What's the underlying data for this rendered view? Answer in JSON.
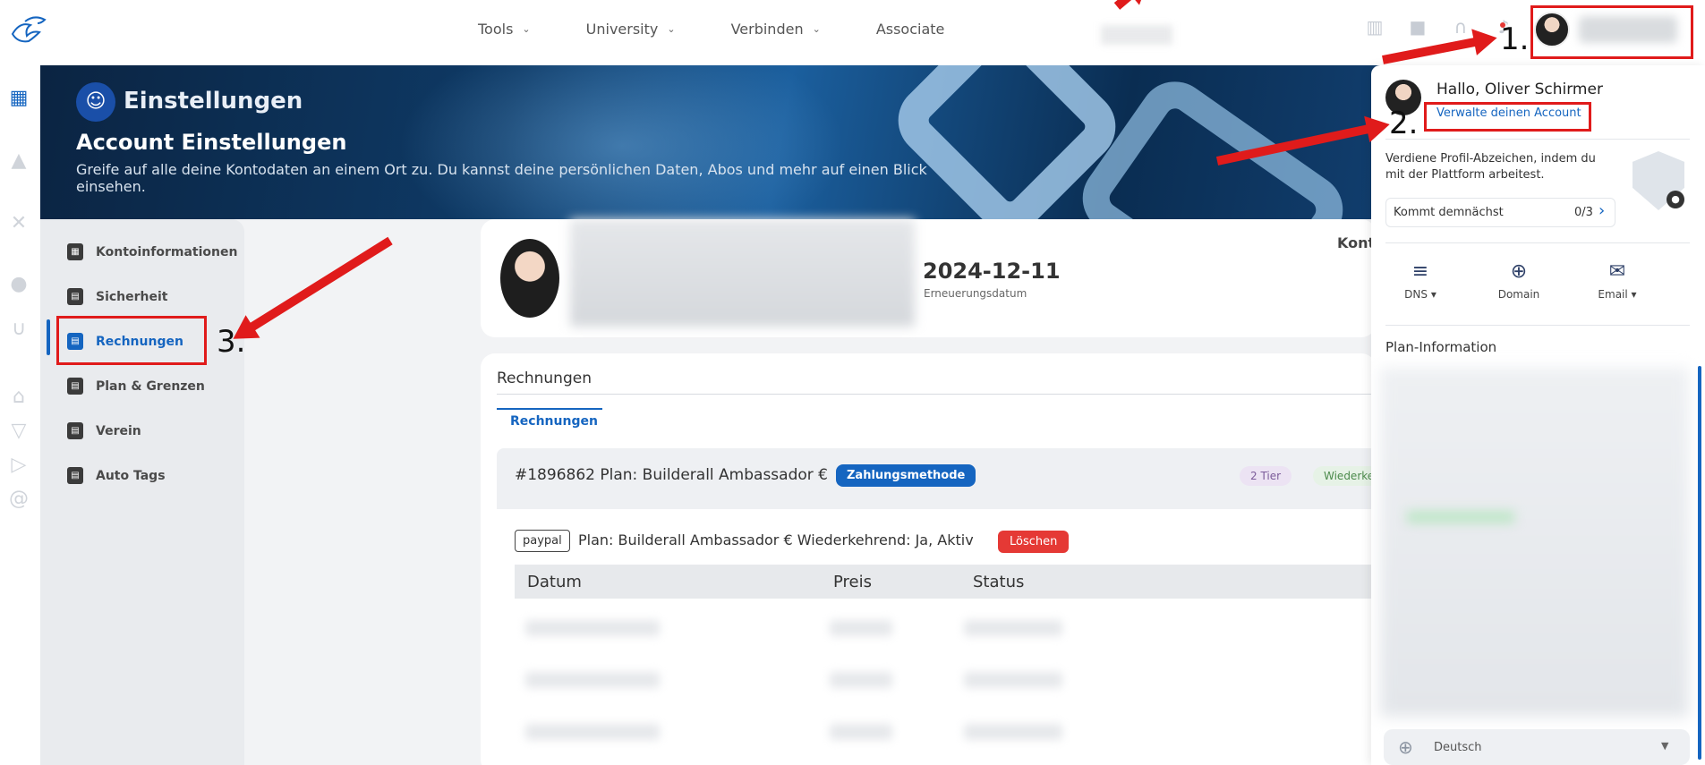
{
  "nav": {
    "items": [
      {
        "label": "Tools",
        "chevron": "⌄"
      },
      {
        "label": "University",
        "chevron": "⌄"
      },
      {
        "label": "Verbinden",
        "chevron": "⌄"
      },
      {
        "label": "Associate",
        "chevron": ""
      }
    ],
    "icons": [
      "book-icon",
      "video-icon",
      "headset-icon",
      "bell-icon"
    ]
  },
  "banner": {
    "title": "Einstellungen",
    "subtitle": "Account Einstellungen",
    "description": "Greife auf alle deine Kontodaten an einem Ort zu. Du kannst deine persönlichen Daten, Abos und mehr auf einen Blick einsehen."
  },
  "menu": {
    "items": [
      {
        "label": "Kontoinformationen"
      },
      {
        "label": "Sicherheit"
      },
      {
        "label": "Rechnungen",
        "active": true
      },
      {
        "label": "Plan & Grenzen"
      },
      {
        "label": "Verein"
      },
      {
        "label": "Auto Tags"
      }
    ]
  },
  "profile_card": {
    "date": "2024-12-11",
    "date_label": "Erneuerungsdatum",
    "kont_label": "Kont"
  },
  "invoices": {
    "title": "Rechnungen",
    "tab": "Rechnungen",
    "plan_header": "#1896862 Plan: Builderall Ambassador €",
    "payment_badge": "Zahlungsmethode",
    "tier_badge": "2 Tier",
    "recurring_badge": "Wiederkehr",
    "payment_provider": "paypal",
    "plan_line": "Plan: Builderall Ambassador € Wiederkehrend: Ja, Aktiv",
    "delete_button": "Löschen",
    "columns": [
      "Datum",
      "Preis",
      "Status"
    ]
  },
  "panel": {
    "greeting": "Hallo, Oliver Schirmer",
    "manage_link": "Verwalte deinen Account",
    "earn_badges": "Verdiene Profil-Abzeichen, indem du mit der Plattform arbeitest.",
    "coming_soon": "Kommt demnächst",
    "coming_soon_count": "0/3",
    "quick_actions": [
      {
        "label": "DNS",
        "icon": "server-icon",
        "caret": "▾"
      },
      {
        "label": "Domain",
        "icon": "globe-www-icon",
        "caret": ""
      },
      {
        "label": "Email",
        "icon": "envelope-icon",
        "caret": "▾"
      }
    ],
    "plan_info": "Plan-Information",
    "language": "Deutsch"
  },
  "annotations": {
    "step1": "1.",
    "step2": "2.",
    "step3": "3."
  },
  "colors": {
    "accent": "#1565c0",
    "annotation_red": "#e01b1b",
    "delete_red": "#e53935"
  }
}
